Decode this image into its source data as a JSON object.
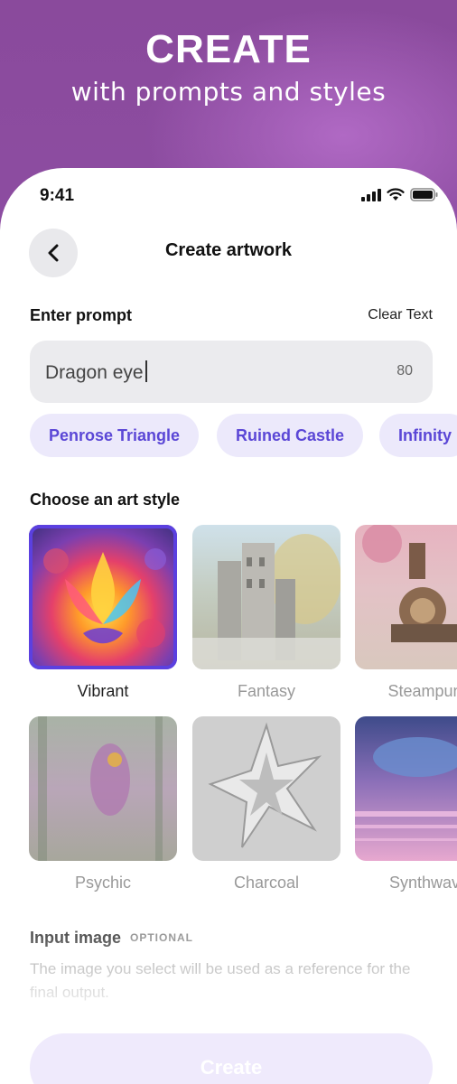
{
  "promo": {
    "title": "CREATE",
    "subtitle": "with prompts and styles"
  },
  "status_bar": {
    "time": "9:41",
    "icons": [
      "signal-icon",
      "wifi-icon",
      "battery-icon"
    ]
  },
  "header": {
    "back_icon": "chevron-left-icon",
    "title": "Create artwork"
  },
  "prompt": {
    "label": "Enter prompt",
    "clear_label": "Clear Text",
    "value": "Dragon eye",
    "char_count": "80"
  },
  "suggestions": [
    "Penrose Triangle",
    "Ruined Castle",
    "Infinity"
  ],
  "art_style": {
    "label": "Choose an art style",
    "selected": "Vibrant",
    "styles": [
      "Vibrant",
      "Fantasy",
      "Steampunk",
      "Psychic",
      "Charcoal",
      "Synthwave"
    ]
  },
  "input_image": {
    "label": "Input image",
    "optional_tag": "OPTIONAL",
    "description": "The image you select will be used as a reference for the final output."
  },
  "create_button": {
    "label": "Create"
  },
  "colors": {
    "accent": "#5b40e0",
    "chip_bg": "#ece9fb",
    "chip_text": "#5b47d6",
    "promo_bg": "#8f4fa6"
  }
}
